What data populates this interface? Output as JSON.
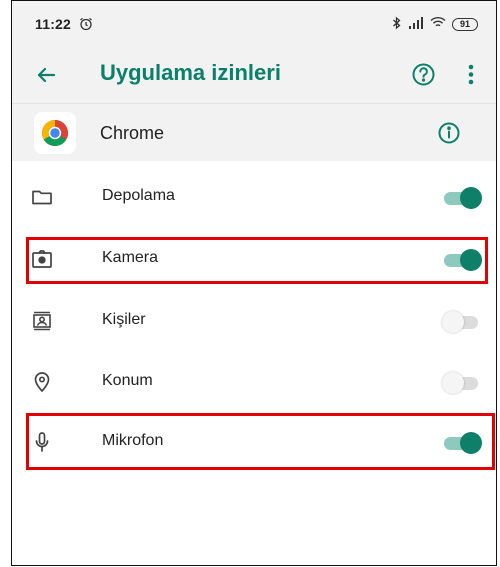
{
  "status_bar": {
    "time": "11:22",
    "battery": "91"
  },
  "app_bar": {
    "title": "Uygulama izinleri",
    "back_icon": "arrow-back-icon",
    "help_icon": "help-circle-icon",
    "more_icon": "more-vert-icon"
  },
  "app": {
    "name": "Chrome",
    "icon": "chrome-icon",
    "info_icon": "info-icon"
  },
  "permissions": [
    {
      "label": "Depolama",
      "icon": "folder-icon",
      "enabled": true
    },
    {
      "label": "Kamera",
      "icon": "camera-icon",
      "enabled": true,
      "highlighted": true
    },
    {
      "label": "Kişiler",
      "icon": "contacts-icon",
      "enabled": false
    },
    {
      "label": "Konum",
      "icon": "location-icon",
      "enabled": false
    },
    {
      "label": "Mikrofon",
      "icon": "microphone-icon",
      "enabled": true,
      "highlighted": true
    }
  ],
  "colors": {
    "accent": "#0e8069",
    "title": "#0a7f69",
    "track_on": "#8ec9bd",
    "highlight": "#e00000",
    "header_bg": "#f2f2f2"
  }
}
